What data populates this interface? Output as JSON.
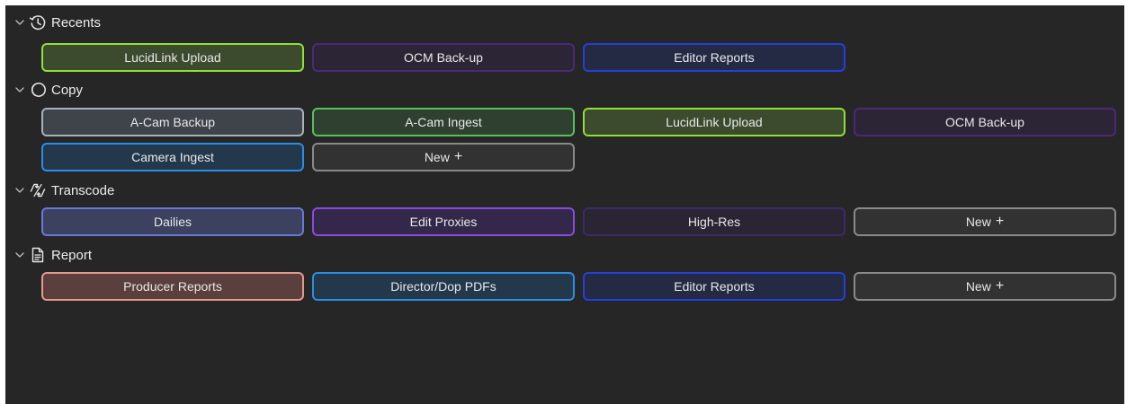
{
  "sections": [
    {
      "title": "Recents",
      "icon": "history-clock-icon",
      "buttons": [
        {
          "label": "LucidLink Upload",
          "border": "#8ee03a",
          "fill": "#3c4a2d"
        },
        {
          "label": "OCM Back-up",
          "border": "#4a2a78",
          "fill": "#2b2536"
        },
        {
          "label": "Editor Reports",
          "border": "#2440d8",
          "fill": "#242a44"
        }
      ]
    },
    {
      "title": "Copy",
      "icon": "copy-circles-icon",
      "buttons": [
        {
          "label": "A-Cam Backup",
          "border": "#a9b1bb",
          "fill": "#3f444b"
        },
        {
          "label": "A-Cam Ingest",
          "border": "#58c25a",
          "fill": "#2f3f30"
        },
        {
          "label": "LucidLink Upload",
          "border": "#8ee03a",
          "fill": "#3c4a2d"
        },
        {
          "label": "OCM Back-up",
          "border": "#4a2a78",
          "fill": "#2b2536"
        },
        {
          "label": "Camera Ingest",
          "border": "#2a8ee6",
          "fill": "#24384c"
        },
        {
          "label": "New",
          "border": "#8a8a8a",
          "fill": "#323232",
          "plus": "+"
        }
      ]
    },
    {
      "title": "Transcode",
      "icon": "transcode-arrows-icon",
      "buttons": [
        {
          "label": "Dailies",
          "border": "#6a78d8",
          "fill": "#3c4160"
        },
        {
          "label": "Edit Proxies",
          "border": "#8a4ae0",
          "fill": "#33284a"
        },
        {
          "label": "High-Res",
          "border": "#3e2a66",
          "fill": "#2a2533"
        },
        {
          "label": "New",
          "border": "#8a8a8a",
          "fill": "#323232",
          "plus": "+"
        }
      ]
    },
    {
      "title": "Report",
      "icon": "document-icon",
      "buttons": [
        {
          "label": "Producer Reports",
          "border": "#e09a8e",
          "fill": "#5a3f3c"
        },
        {
          "label": "Director/Dop PDFs",
          "border": "#2a8ee6",
          "fill": "#24384c"
        },
        {
          "label": "Editor Reports",
          "border": "#2440d8",
          "fill": "#242a44"
        },
        {
          "label": "New",
          "border": "#8a8a8a",
          "fill": "#323232",
          "plus": "+"
        }
      ]
    }
  ]
}
